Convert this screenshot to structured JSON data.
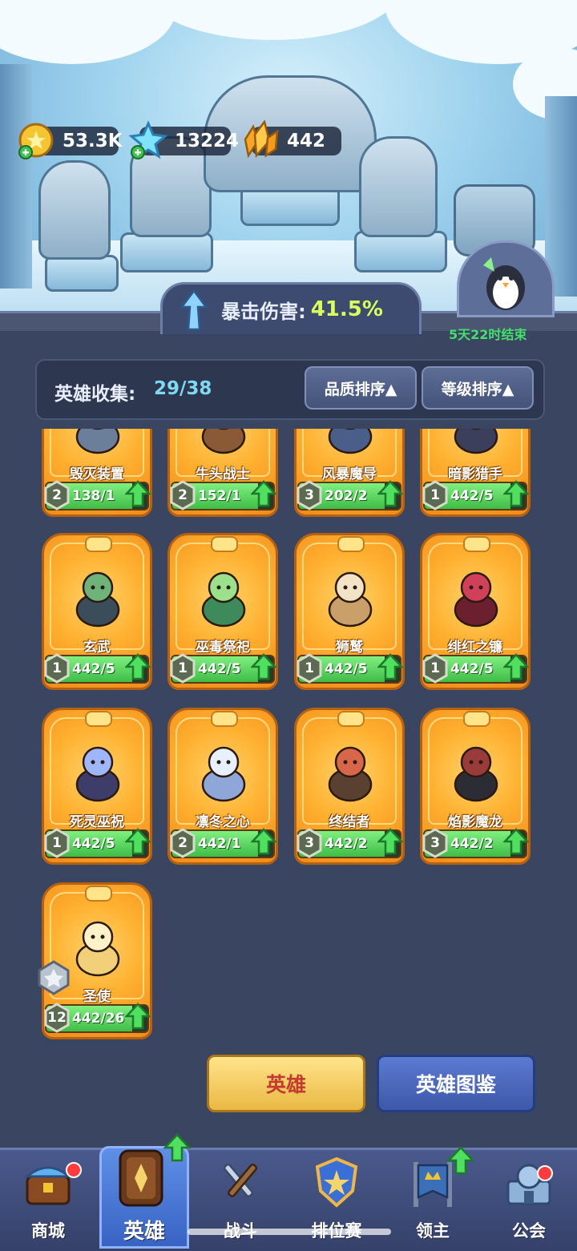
{
  "resources": [
    {
      "icon": "gold-coin-icon",
      "value": "53.3K"
    },
    {
      "icon": "ice-crystal-icon",
      "value": "13224"
    },
    {
      "icon": "amber-gem-icon",
      "value": "442"
    }
  ],
  "crit": {
    "label": "暴击伤害:",
    "value": "41.5%"
  },
  "event": {
    "countdown": "5天22时结束"
  },
  "collection": {
    "label": "英雄收集:",
    "count": "29/38",
    "sort_quality": "品质排序▲",
    "sort_level": "等级排序▲"
  },
  "heroes": [
    {
      "name": "毁灭装置",
      "level": "2",
      "progress": "138/1",
      "fill": 0.85
    },
    {
      "name": "牛头战士",
      "level": "2",
      "progress": "152/1",
      "fill": 0.85
    },
    {
      "name": "风暴魔导",
      "level": "3",
      "progress": "202/2",
      "fill": 0.85
    },
    {
      "name": "暗影猎手",
      "level": "1",
      "progress": "442/5",
      "fill": 0.85
    },
    {
      "name": "玄武",
      "level": "1",
      "progress": "442/5",
      "fill": 0.85
    },
    {
      "name": "巫毒祭祀",
      "level": "1",
      "progress": "442/5",
      "fill": 0.85
    },
    {
      "name": "狮鹫",
      "level": "1",
      "progress": "442/5",
      "fill": 0.85
    },
    {
      "name": "绯红之镰",
      "level": "1",
      "progress": "442/5",
      "fill": 0.85
    },
    {
      "name": "死灵巫祝",
      "level": "1",
      "progress": "442/5",
      "fill": 0.85
    },
    {
      "name": "凛冬之心",
      "level": "2",
      "progress": "442/1",
      "fill": 0.85
    },
    {
      "name": "终结者",
      "level": "3",
      "progress": "442/2",
      "fill": 0.85
    },
    {
      "name": "焰影魔龙",
      "level": "3",
      "progress": "442/2",
      "fill": 0.85
    },
    {
      "name": "圣使",
      "level": "12",
      "progress": "442/26",
      "fill": 0.85
    }
  ],
  "buttons": {
    "heroes": "英雄",
    "codex": "英雄图鉴"
  },
  "nav": [
    {
      "label": "商城"
    },
    {
      "label": "英雄"
    },
    {
      "label": "战斗"
    },
    {
      "label": "排位赛"
    },
    {
      "label": "领主"
    },
    {
      "label": "公会"
    }
  ],
  "colors": {
    "accent_green": "#44e06a",
    "crit_value": "#d9ff5a",
    "card_orange": "#ffb02f",
    "nav_active": "#3863c4"
  }
}
